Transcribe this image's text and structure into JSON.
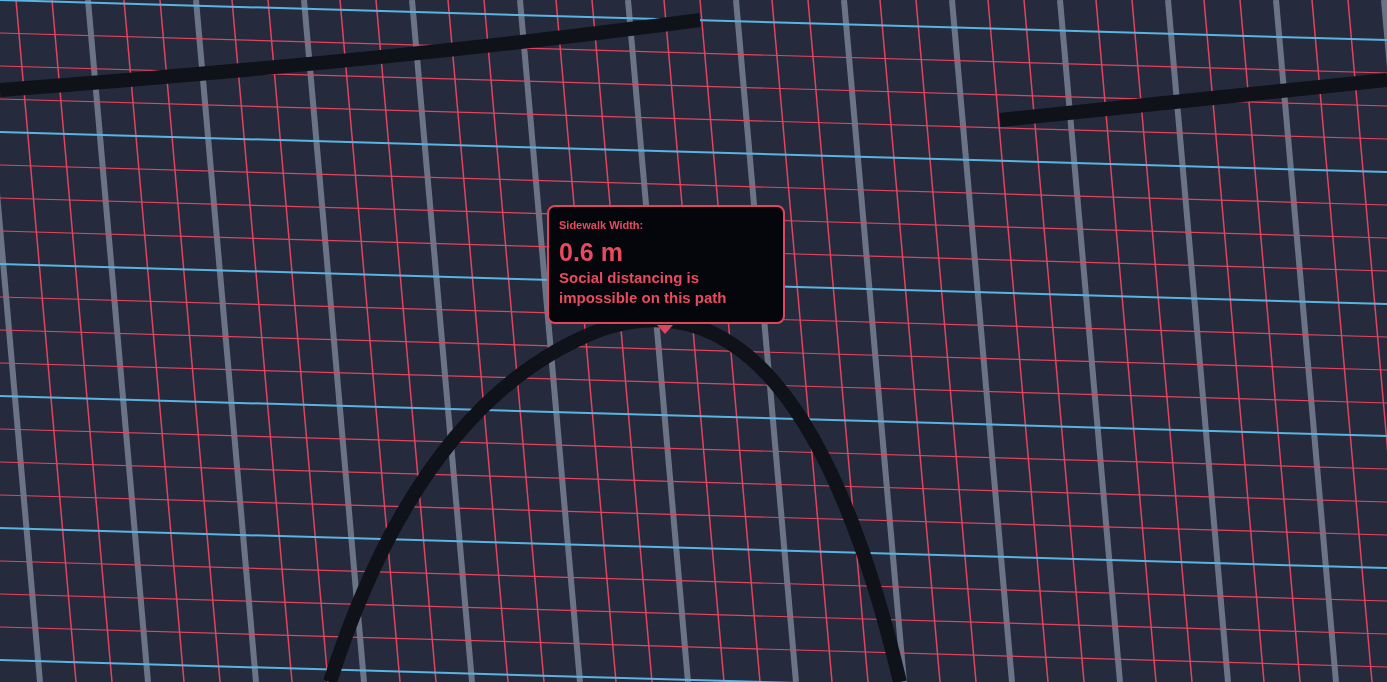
{
  "tooltip": {
    "label": "Sidewalk Width:",
    "value": "0.6 m",
    "message": "Social distancing is impossible on this path"
  }
}
